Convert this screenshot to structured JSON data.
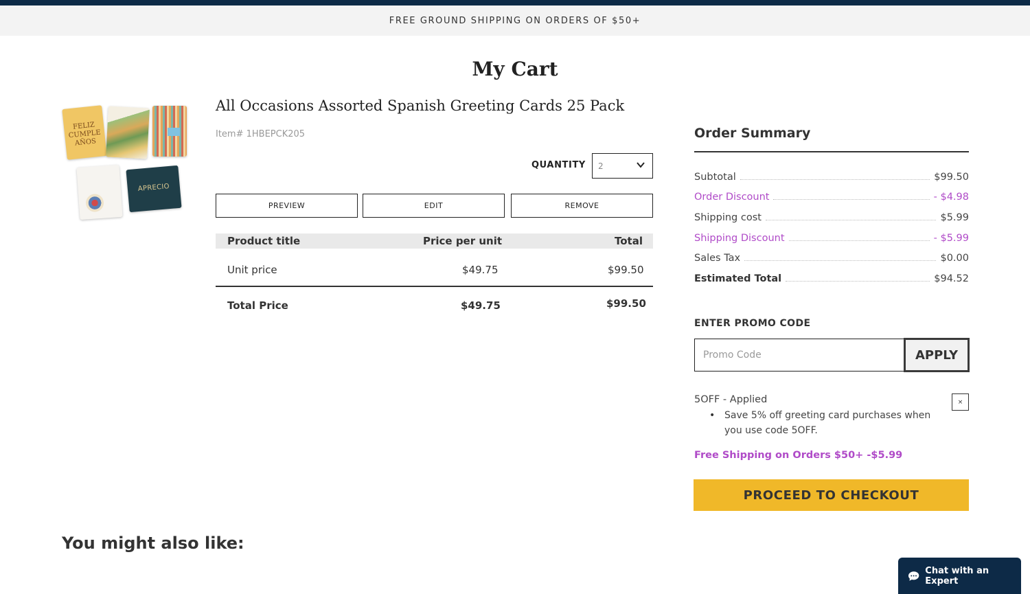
{
  "banner": {
    "text": "FREE GROUND SHIPPING ON ORDERS OF $50+"
  },
  "page": {
    "title": "My Cart"
  },
  "product": {
    "title": "All Occasions Assorted Spanish Greeting Cards 25 Pack",
    "item_number": "Item# 1HBEPCK205",
    "thumb_card_1_text": "FELIZ CUMPLE AÑOS",
    "thumb_card_5_text": "APRECIO",
    "quantity_label": "QUANTITY",
    "quantity_value": "2",
    "actions": {
      "preview": "PREVIEW",
      "edit": "EDIT",
      "remove": "REMOVE"
    },
    "table": {
      "headers": {
        "title": "Product title",
        "price": "Price per unit",
        "total": "Total"
      },
      "row": {
        "label": "Unit price",
        "price": "$49.75",
        "total": "$99.50"
      },
      "footer": {
        "label": "Total Price",
        "price": "$49.75",
        "total": "$99.50"
      }
    }
  },
  "summary": {
    "title": "Order Summary",
    "rows": [
      {
        "label": "Subtotal",
        "value": "$99.50"
      },
      {
        "label": "Order Discount",
        "value": "- $4.98"
      },
      {
        "label": "Shipping cost",
        "value": "$5.99"
      },
      {
        "label": "Shipping Discount",
        "value": "- $5.99"
      },
      {
        "label": "Sales Tax",
        "value": "$0.00"
      },
      {
        "label": "Estimated Total",
        "value": "$94.52"
      }
    ],
    "promo": {
      "label": "ENTER PROMO CODE",
      "placeholder": "Promo Code",
      "apply": "APPLY",
      "applied": "5OFF - Applied",
      "remove": "×",
      "description": "Save 5% off greeting card purchases when you use code 5OFF.",
      "free_shipping": "Free Shipping on Orders $50+ -$5.99"
    },
    "checkout": "PROCEED TO CHECKOUT"
  },
  "recommendations": {
    "title": "You might also like:"
  },
  "chat": {
    "label": "Chat with an Expert"
  },
  "colors": {
    "navy": "#0d2a47",
    "accent_purple": "#b04bc8",
    "checkout_yellow": "#f0b829"
  }
}
